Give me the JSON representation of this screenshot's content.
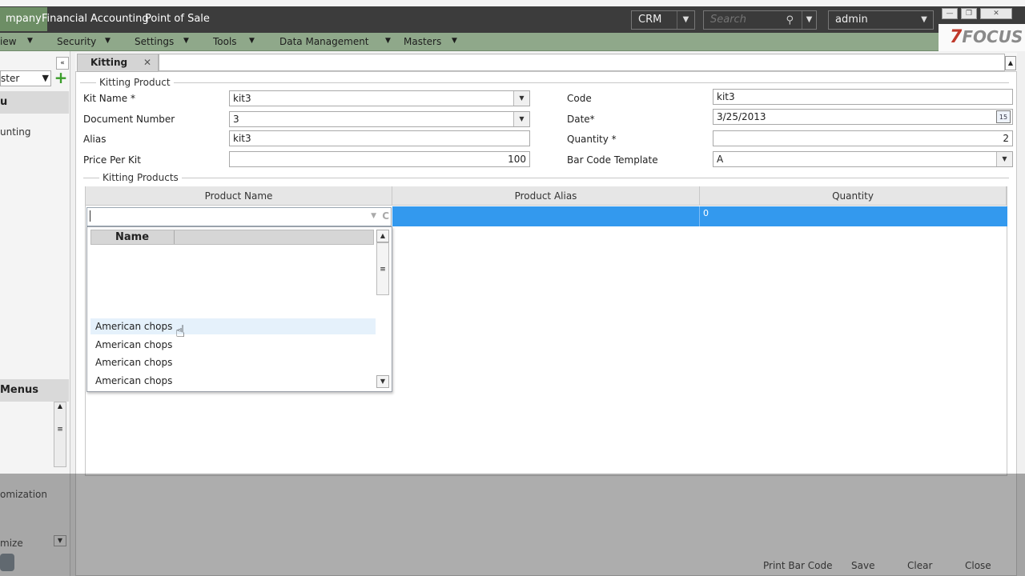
{
  "header": {
    "modules": [
      "Company",
      "Financial Accounting",
      "Point of Sale"
    ],
    "active_module": "Company",
    "module_display": [
      "mpany",
      "Financial Accounting",
      "Point of Sale"
    ],
    "crm_select": "CRM",
    "search_placeholder": "Search",
    "user_select": "admin",
    "logo_text": "FOCUS"
  },
  "menubar": {
    "items": [
      "iew",
      "Security",
      "Settings",
      "Tools",
      "Data Management",
      "Masters"
    ]
  },
  "sidebar": {
    "select_value": "ster",
    "menu_heading": "u",
    "accounting_item": "unting",
    "menus_heading": "Menus",
    "customization_item": "omization",
    "customize_item": "mize"
  },
  "tab": {
    "label": "Kitting",
    "close": "✕"
  },
  "form": {
    "section_title": "Kitting Product",
    "kit_name_label": "Kit Name *",
    "kit_name_value": "kit3",
    "document_number_label": "Document Number",
    "document_number_value": "3",
    "alias_label": "Alias",
    "alias_value": "kit3",
    "price_per_kit_label": "Price Per Kit",
    "price_per_kit_value": "100",
    "code_label": "Code",
    "code_value": "kit3",
    "date_label": "Date*",
    "date_value": "3/25/2013",
    "calendar_day": "15",
    "quantity_label": "Quantity *",
    "quantity_value": "2",
    "bar_code_template_label": "Bar Code Template",
    "bar_code_template_value": "A"
  },
  "grid": {
    "section_title": "Kitting Products",
    "columns": [
      "Product Name",
      "Product Alias",
      "Quantity"
    ],
    "row_quantity": "0",
    "cell_input_value": "",
    "cell_icon_text": "C"
  },
  "popup": {
    "header": "Name",
    "items": [
      "American chops",
      "American chops",
      "American chops",
      "American chops"
    ],
    "hover_index": 0
  },
  "footer": {
    "buttons": [
      "Print Bar Code",
      "Save",
      "Clear",
      "Close"
    ]
  },
  "colors": {
    "topbar": "#3c3c3c",
    "menubar": "#8fa88a",
    "active_module": "#6d8e65",
    "selection": "#3399ee"
  }
}
